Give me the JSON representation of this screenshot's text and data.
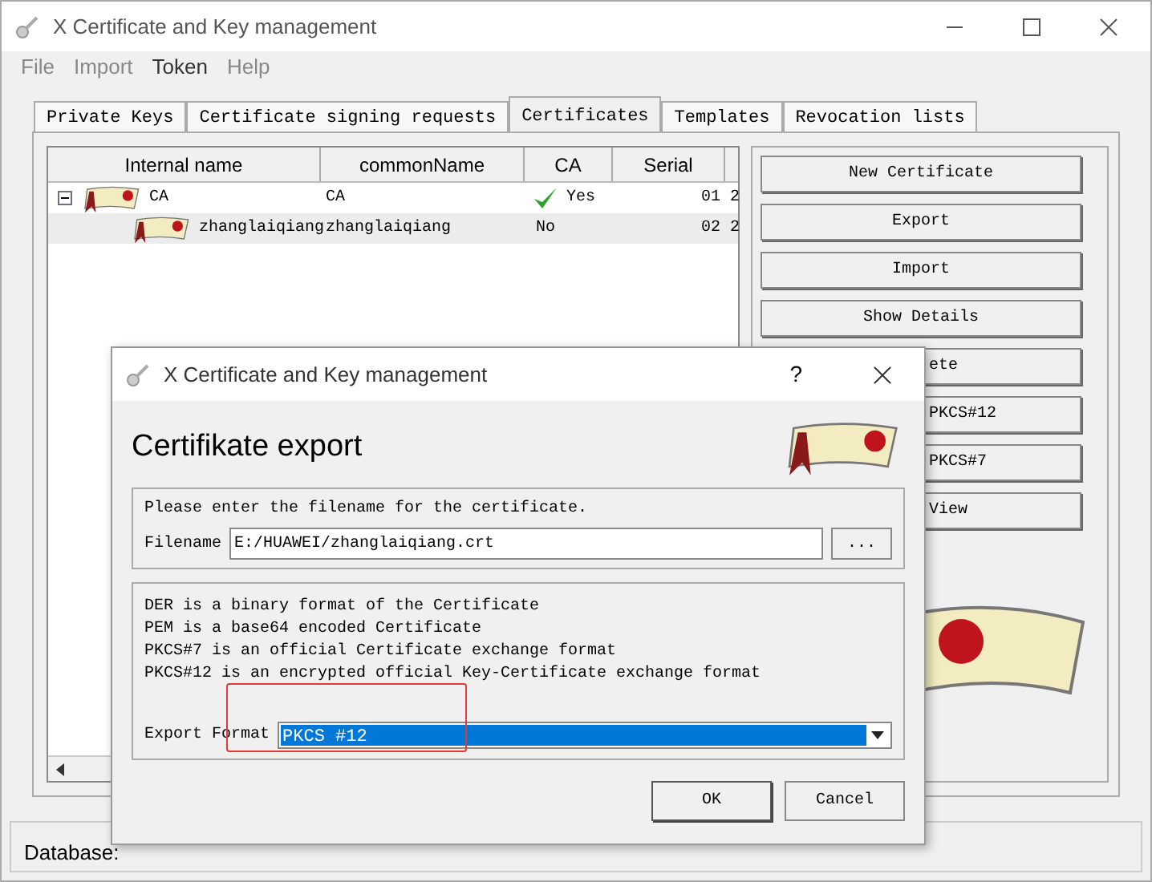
{
  "window": {
    "title": "X Certificate and Key management"
  },
  "menu": [
    {
      "label": "File",
      "disabled": true
    },
    {
      "label": "Import",
      "disabled": true
    },
    {
      "label": "Token",
      "disabled": false
    },
    {
      "label": "Help",
      "disabled": true
    }
  ],
  "tabs": [
    {
      "label": "Private Keys",
      "selected": false
    },
    {
      "label": "Certificate signing requests",
      "selected": false
    },
    {
      "label": "Certificates",
      "selected": true
    },
    {
      "label": "Templates",
      "selected": false
    },
    {
      "label": "Revocation lists",
      "selected": false
    }
  ],
  "table": {
    "columns": [
      "Internal name",
      "commonName",
      "CA",
      "Serial"
    ],
    "rows": [
      {
        "cells": [
          "CA",
          "CA",
          "Yes",
          "01",
          "2"
        ],
        "checked": true,
        "expanded": true,
        "children": [
          {
            "cells": [
              "zhanglaiqiang",
              "zhanglaiqiang",
              "No",
              "02",
              "2"
            ],
            "checked": false
          }
        ]
      }
    ]
  },
  "buttons": [
    {
      "label": "New Certificate",
      "partly_hidden": false
    },
    {
      "label": "Export",
      "partly_hidden": false
    },
    {
      "label": "Import",
      "partly_hidden": false
    },
    {
      "label": "Show Details",
      "partly_hidden": false
    },
    {
      "label": "ete",
      "partly_hidden": true
    },
    {
      "label": "PKCS#12",
      "partly_hidden": true
    },
    {
      "label": "PKCS#7",
      "partly_hidden": true
    },
    {
      "label": "View",
      "partly_hidden": true
    }
  ],
  "status_bar": "Database:",
  "dialog": {
    "title": "X Certificate and Key management",
    "help": "?",
    "heading": "Certifikate export",
    "filename_prompt": "Please enter the filename for the certificate.",
    "filename_label": "Filename",
    "filename": "E:/HUAWEI/zhanglaiqiang.crt",
    "browse": "...",
    "info": [
      "DER is a binary format of the Certificate",
      "PEM is a base64 encoded Certificate",
      "PKCS#7 is an official Certificate exchange format",
      "PKCS#12 is an encrypted official Key-Certificate exchange format"
    ],
    "format_label": "Export Format",
    "format": "PKCS #12",
    "highlighted": true,
    "buttons": [
      "OK",
      "Cancel"
    ]
  }
}
